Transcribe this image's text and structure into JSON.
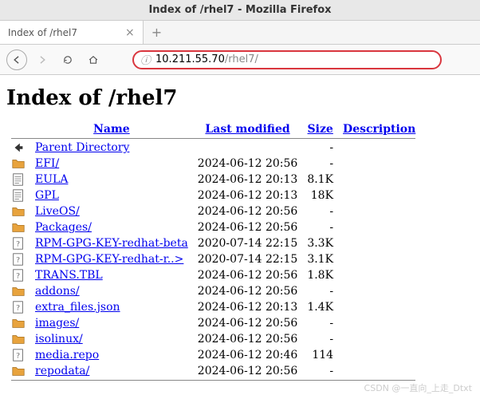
{
  "window": {
    "title": "Index of /rhel7 - Mozilla Firefox"
  },
  "tab": {
    "title": "Index of /rhel7"
  },
  "url": {
    "host": "10.211.55.70",
    "path": "/rhel7/"
  },
  "page": {
    "heading": "Index of /rhel7"
  },
  "columns": {
    "name": "Name",
    "modified": "Last modified",
    "size": "Size",
    "desc": "Description"
  },
  "rows": [
    {
      "icon": "back",
      "name": "Parent Directory",
      "modified": "",
      "size": "-",
      "desc": ""
    },
    {
      "icon": "folder",
      "name": "EFI/",
      "modified": "2024-06-12 20:56",
      "size": "-",
      "desc": ""
    },
    {
      "icon": "text",
      "name": "EULA",
      "modified": "2024-06-12 20:13",
      "size": "8.1K",
      "desc": ""
    },
    {
      "icon": "text",
      "name": "GPL",
      "modified": "2024-06-12 20:13",
      "size": "18K",
      "desc": ""
    },
    {
      "icon": "folder",
      "name": "LiveOS/",
      "modified": "2024-06-12 20:56",
      "size": "-",
      "desc": ""
    },
    {
      "icon": "folder",
      "name": "Packages/",
      "modified": "2024-06-12 20:56",
      "size": "-",
      "desc": ""
    },
    {
      "icon": "unknown",
      "name": "RPM-GPG-KEY-redhat-beta",
      "modified": "2020-07-14 22:15",
      "size": "3.3K",
      "desc": ""
    },
    {
      "icon": "unknown",
      "name": "RPM-GPG-KEY-redhat-r..>",
      "modified": "2020-07-14 22:15",
      "size": "3.1K",
      "desc": ""
    },
    {
      "icon": "unknown",
      "name": "TRANS.TBL",
      "modified": "2024-06-12 20:56",
      "size": "1.8K",
      "desc": ""
    },
    {
      "icon": "folder",
      "name": "addons/",
      "modified": "2024-06-12 20:56",
      "size": "-",
      "desc": ""
    },
    {
      "icon": "unknown",
      "name": "extra_files.json",
      "modified": "2024-06-12 20:13",
      "size": "1.4K",
      "desc": ""
    },
    {
      "icon": "folder",
      "name": "images/",
      "modified": "2024-06-12 20:56",
      "size": "-",
      "desc": ""
    },
    {
      "icon": "folder",
      "name": "isolinux/",
      "modified": "2024-06-12 20:56",
      "size": "-",
      "desc": ""
    },
    {
      "icon": "unknown",
      "name": "media.repo",
      "modified": "2024-06-12 20:46",
      "size": "114",
      "desc": ""
    },
    {
      "icon": "folder",
      "name": "repodata/",
      "modified": "2024-06-12 20:56",
      "size": "-",
      "desc": ""
    }
  ],
  "watermark": "CSDN @一直向_上走_Dtxt"
}
